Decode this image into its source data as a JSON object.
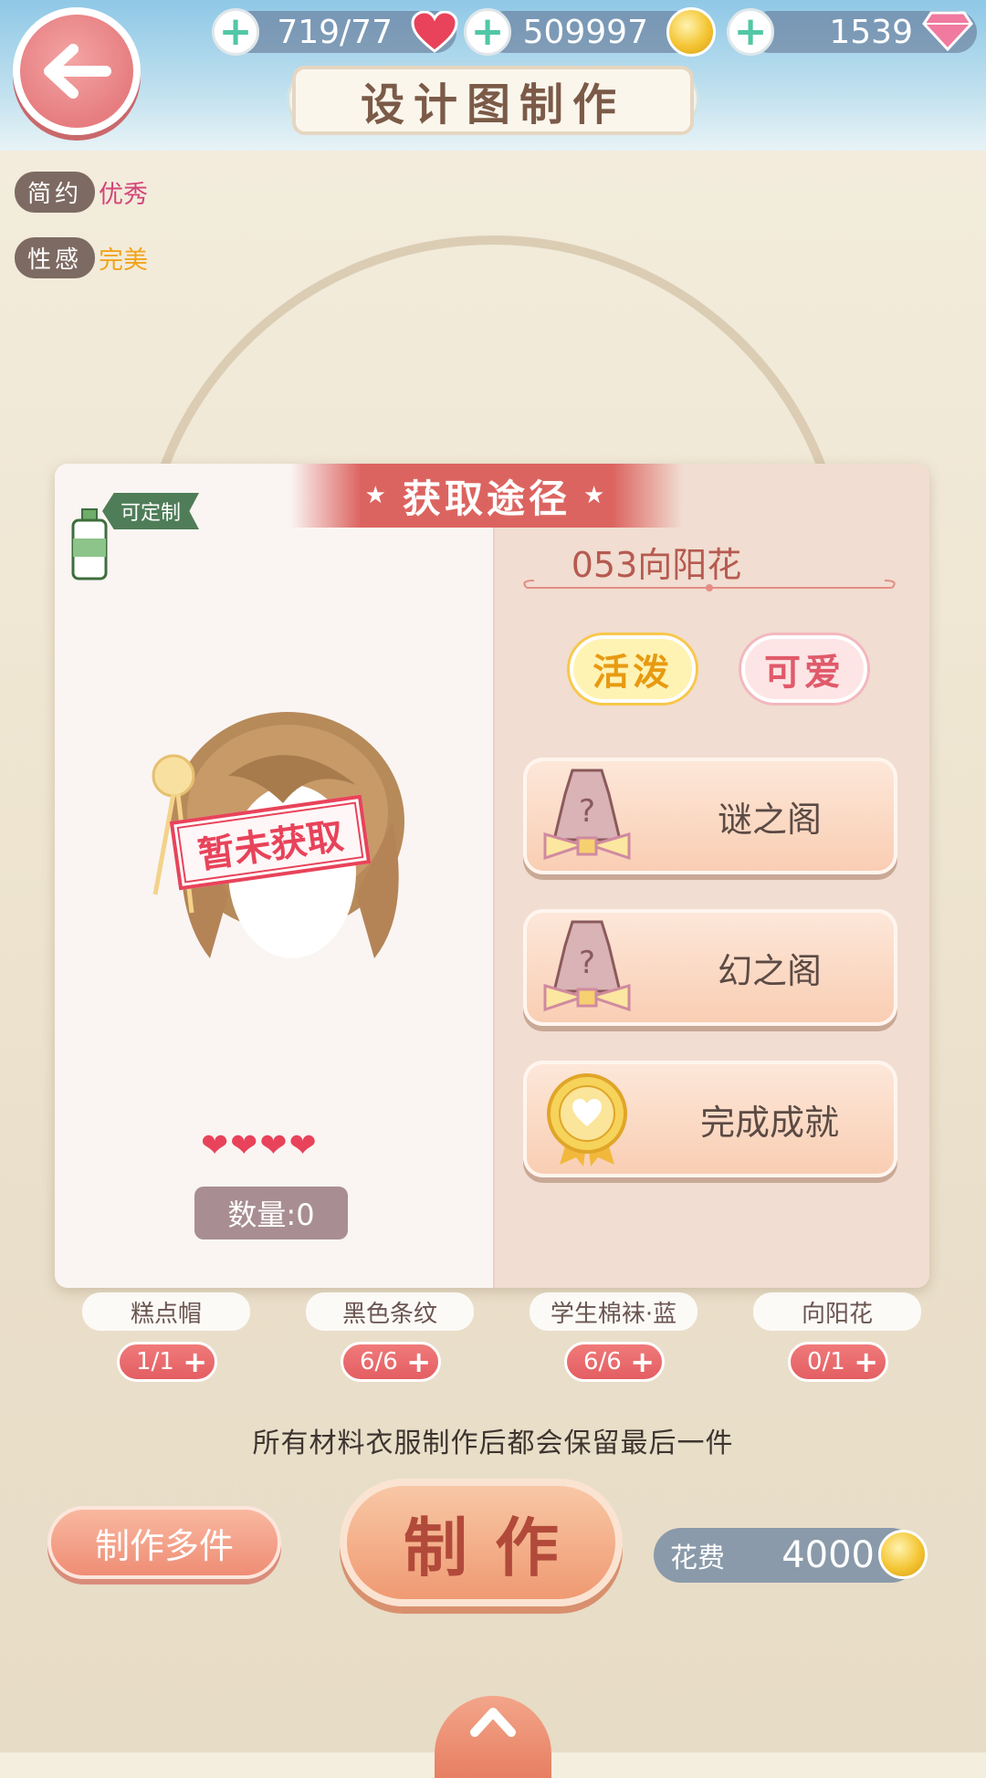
{
  "header": {
    "title": "设计图制作",
    "stamina": "719/77",
    "gold": "509997",
    "diamonds": "1539"
  },
  "tags": [
    {
      "label": "简约",
      "value": "优秀",
      "color": "#d2457a"
    },
    {
      "label": "性感",
      "value": "完美",
      "color": "#f2a31a"
    }
  ],
  "panel": {
    "banner": "获取途径",
    "custom_tag": "可定制",
    "status_stamp": "暂未获取",
    "rarity_hearts": 4,
    "quantity": "数量:0",
    "item_name": "053向阳花",
    "style_tags": [
      {
        "label": "活泼",
        "color": "#f2a31a"
      },
      {
        "label": "可爱",
        "color": "#e05a6a"
      }
    ],
    "sources": [
      {
        "label": "谜之阁",
        "icon": "mystery-dress-icon"
      },
      {
        "label": "幻之阁",
        "icon": "mystery-dress-icon"
      },
      {
        "label": "完成成就",
        "icon": "nikki-medal-icon"
      }
    ]
  },
  "materials": [
    {
      "name": "糕点帽",
      "count": "1/1"
    },
    {
      "name": "黑色条纹",
      "count": "6/6"
    },
    {
      "name": "学生棉袜·蓝",
      "count": "6/6"
    },
    {
      "name": "向阳花",
      "count": "0/1"
    }
  ],
  "note": "所有材料衣服制作后都会保留最后一件",
  "actions": {
    "make_multiple": "制作多件",
    "make": "制作",
    "cost_label": "花费",
    "cost_value": "4000"
  }
}
